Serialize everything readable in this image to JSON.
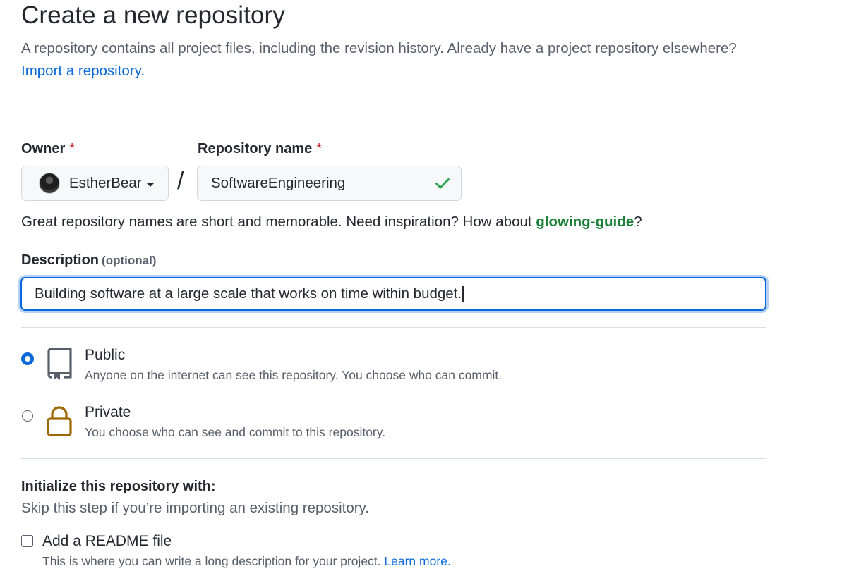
{
  "header": {
    "title": "Create a new repository",
    "subtitle": "A repository contains all project files, including the revision history. Already have a project repository elsewhere?",
    "import_link": "Import a repository."
  },
  "owner": {
    "label": "Owner",
    "required_mark": "*",
    "value": "EstherBear"
  },
  "separator": "/",
  "repository_name": {
    "label": "Repository name",
    "required_mark": "*",
    "value": "SoftwareEngineering",
    "valid_icon": "check-icon"
  },
  "name_hint": {
    "text": "Great repository names are short and memorable. Need inspiration? How about ",
    "suggestion": "glowing-guide",
    "end": "?"
  },
  "description": {
    "label": "Description",
    "optional": "(optional)",
    "value": "Building software at a large scale that works on time within budget."
  },
  "visibility": {
    "options": [
      {
        "title": "Public",
        "desc": "Anyone on the internet can see this repository. You choose who can commit.",
        "icon": "repo-icon",
        "selected": true
      },
      {
        "title": "Private",
        "desc": "You choose who can see and commit to this repository.",
        "icon": "lock-icon",
        "selected": false
      }
    ]
  },
  "initialize": {
    "title": "Initialize this repository with:",
    "subtitle": "Skip this step if you’re importing an existing repository.",
    "readme": {
      "label": "Add a README file",
      "desc": "This is where you can write a long description for your project. ",
      "learn_more": "Learn more.",
      "checked": false
    }
  },
  "colors": {
    "accent": "#0969da",
    "success": "#1a7f37",
    "required": "#cf222e",
    "lock": "#9a6700"
  }
}
